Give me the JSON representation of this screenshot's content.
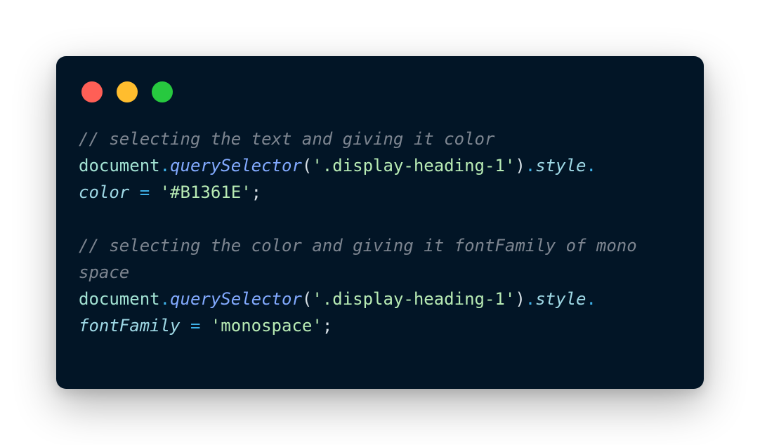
{
  "window": {
    "traffic_lights": {
      "close_color": "#FF5F56",
      "minimize_color": "#FFBD2E",
      "maximize_color": "#27C93F"
    },
    "background_color": "#021526"
  },
  "code": {
    "comment_1_line_1": "// selecting the text and giving it color",
    "stmt_1_object": "document",
    "stmt_1_dot_1": ".",
    "stmt_1_method": "querySelector",
    "stmt_1_open_paren": "(",
    "stmt_1_selector": "'.display-heading-1'",
    "stmt_1_close_paren": ")",
    "stmt_1_dot_2": ".",
    "stmt_1_style": "style",
    "stmt_1_dot_3": ".",
    "stmt_1_property": "color",
    "stmt_1_operator": " = ",
    "stmt_1_value": "'#B1361E'",
    "stmt_1_semicolon": ";",
    "comment_2_line_1": "// selecting the color and giving it fontFamily of mono",
    "comment_2_line_2": "space",
    "stmt_2_object": "document",
    "stmt_2_dot_1": ".",
    "stmt_2_method": "querySelector",
    "stmt_2_open_paren": "(",
    "stmt_2_selector": "'.display-heading-1'",
    "stmt_2_close_paren": ")",
    "stmt_2_dot_2": ".",
    "stmt_2_style": "style",
    "stmt_2_dot_3": ".",
    "stmt_2_property": "fontFamily",
    "stmt_2_operator": " = ",
    "stmt_2_value": "'monospace'",
    "stmt_2_semicolon": ";"
  }
}
